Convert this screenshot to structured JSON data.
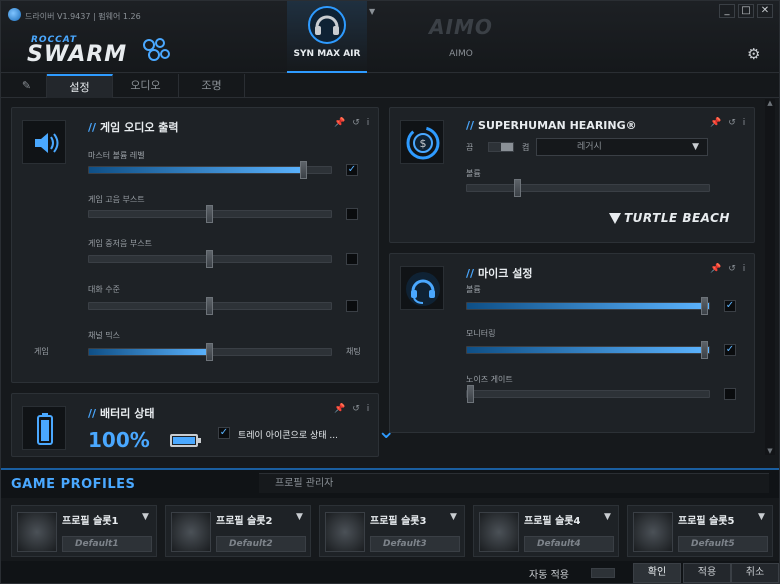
{
  "window": {
    "title": "드라이버 V1.9437 | 펌웨어 1.26",
    "minimize": "_",
    "maximize": "□",
    "close": "✕"
  },
  "brand": {
    "line1": "ROCCAT",
    "line2": "SWARM"
  },
  "devices": {
    "active_label": "SYN MAX AIR",
    "dropdown": "▼",
    "other_logo": "AIMO",
    "other_label": "AIMO"
  },
  "tabs": {
    "pin": "📌",
    "items": [
      "설정",
      "오디오",
      "조명"
    ]
  },
  "game_audio": {
    "title": "게임 오디오 출력",
    "tools": "📌↺i",
    "master_volume": {
      "label": "마스터 볼륨 레벨",
      "value": 0.9,
      "checked": true
    },
    "treble_boost": {
      "label": "게임 고음 부스트",
      "value": 0.5,
      "checked": false
    },
    "bass_boost": {
      "label": "게임 중저음 부스트",
      "value": 0.5,
      "checked": false
    },
    "chat_level": {
      "label": "대화 수준",
      "value": 0.5,
      "checked": false
    },
    "chat_mix": {
      "label": "채널 믹스",
      "value": 0.5,
      "left": "게임",
      "right": "채팅"
    }
  },
  "battery": {
    "title": "배터리 상태",
    "tools": "📌↺i",
    "percent": "100%",
    "level": 1.0,
    "tray_label": "트레이 아이콘으로 상태 ...",
    "tray_checked": true
  },
  "superhuman": {
    "title": "SUPERHUMAN HEARING®",
    "tools": "📌↺i",
    "on": "켬",
    "off": "끔",
    "preset": "레거시",
    "volume_label": "볼륨",
    "volume_value": 0.2,
    "partner_logo": "TURTLE BEACH"
  },
  "mic": {
    "title": "마이크 설정",
    "tools": "📌↺i",
    "volume": {
      "label": "볼륨",
      "value": 1.0,
      "checked": true
    },
    "monitor": {
      "label": "모니터링",
      "value": 1.0,
      "checked": true
    },
    "noise_gate": {
      "label": "노이즈 게이트",
      "value": 0.0,
      "checked": false
    }
  },
  "profiles": {
    "title": "GAME PROFILES",
    "manager_tab": "프로필 관리자",
    "slots": [
      {
        "name": "프로필 슬롯1",
        "value": "Default1"
      },
      {
        "name": "프로필 슬롯2",
        "value": "Default2"
      },
      {
        "name": "프로필 슬롯3",
        "value": "Default3"
      },
      {
        "name": "프로필 슬롯4",
        "value": "Default4"
      },
      {
        "name": "프로필 슬롯5",
        "value": "Default5"
      }
    ]
  },
  "footer": {
    "auto_apply": "자동 적용",
    "ok": "확인",
    "apply": "적용",
    "cancel": "취소"
  },
  "colors": {
    "accent": "#2e9bff",
    "panel": "#1e2226",
    "background": "#16191c"
  }
}
